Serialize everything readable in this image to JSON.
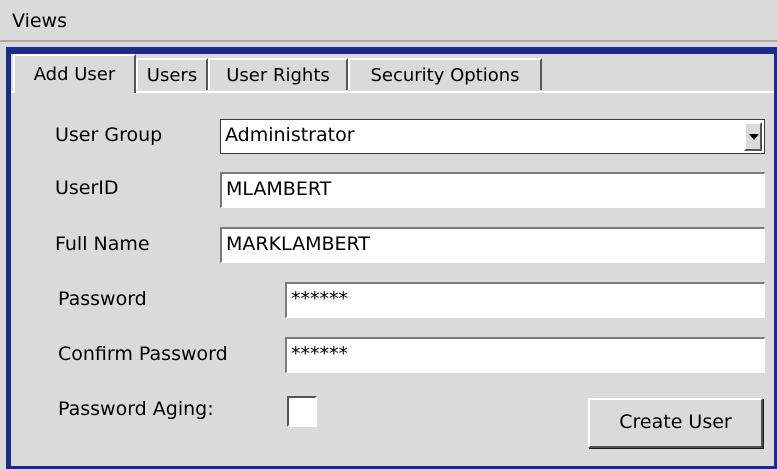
{
  "header": {
    "title": "Views"
  },
  "tabs": [
    {
      "label": "Add User",
      "active": true
    },
    {
      "label": "Users",
      "active": false
    },
    {
      "label": "User Rights",
      "active": false
    },
    {
      "label": "Security Options",
      "active": false
    }
  ],
  "form": {
    "user_group": {
      "label": "User Group",
      "value": "Administrator"
    },
    "user_id": {
      "label": "UserID",
      "value": "MLAMBERT"
    },
    "full_name": {
      "label": "Full Name",
      "value": "MARKLAMBERT"
    },
    "password": {
      "label": "Password",
      "value": "******"
    },
    "confirm_password": {
      "label": "Confirm Password",
      "value": "******"
    },
    "password_aging": {
      "label": "Password Aging:",
      "checked": false
    },
    "create_button": "Create User"
  },
  "icons": {
    "dropdown": "chevron-down-icon"
  },
  "colors": {
    "window_border": "#1c2b88",
    "background": "#dadada"
  }
}
